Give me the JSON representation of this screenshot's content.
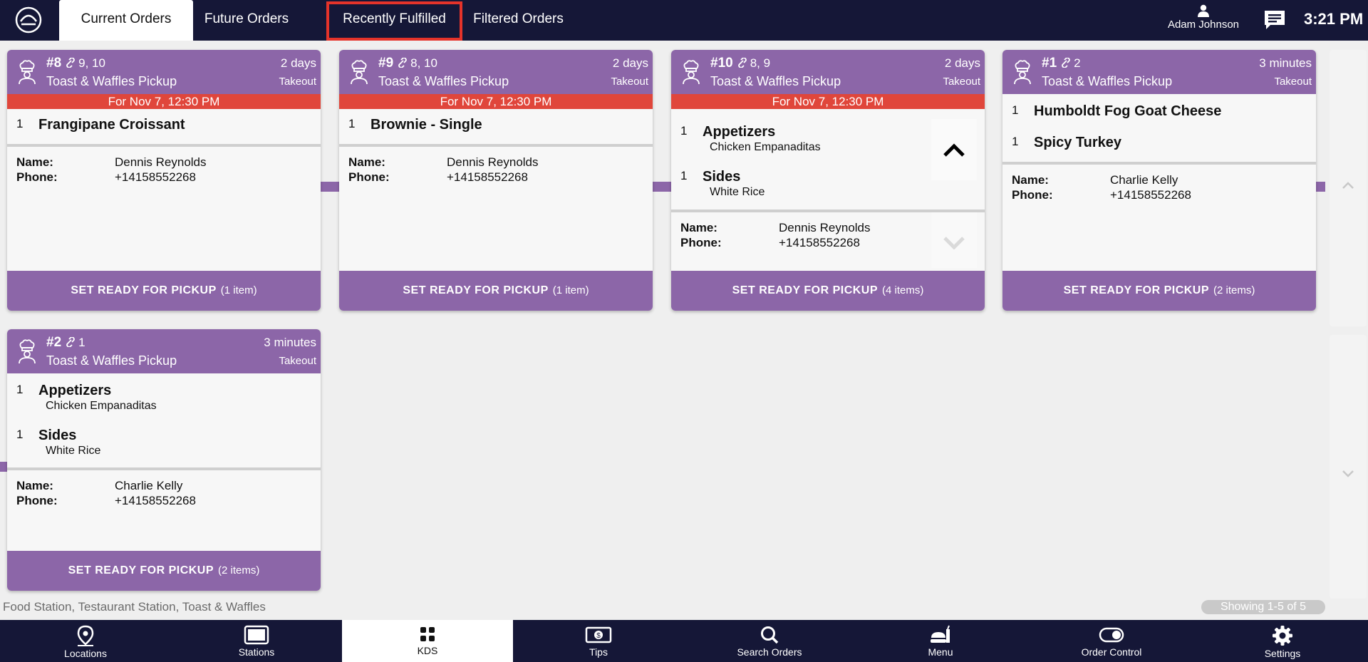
{
  "tabs": [
    {
      "label": "Current Orders"
    },
    {
      "label": "Future Orders"
    },
    {
      "label": "Recently Fulfilled"
    },
    {
      "label": "Filtered Orders"
    }
  ],
  "user": {
    "name": "Adam Johnson"
  },
  "clock": "3:21 PM",
  "labels": {
    "name": "Name:",
    "phone": "Phone:",
    "set_ready": "SET READY FOR PICKUP"
  },
  "orders": [
    {
      "number": "#8",
      "linked": "9, 10",
      "service": "Toast & Waffles Pickup",
      "age": "2 days",
      "type": "Takeout",
      "due": "For Nov 7, 12:30 PM",
      "items": [
        {
          "qty": "1",
          "name": "Frangipane Croissant"
        }
      ],
      "customer": {
        "name": "Dennis Reynolds",
        "phone": "+14158552268"
      },
      "item_count": "(1 item)"
    },
    {
      "number": "#9",
      "linked": "8, 10",
      "service": "Toast & Waffles Pickup",
      "age": "2 days",
      "type": "Takeout",
      "due": "For Nov 7, 12:30 PM",
      "items": [
        {
          "qty": "1",
          "name": "Brownie - Single"
        }
      ],
      "customer": {
        "name": "Dennis Reynolds",
        "phone": "+14158552268"
      },
      "item_count": "(1 item)"
    },
    {
      "number": "#10",
      "linked": "8, 9",
      "service": "Toast & Waffles Pickup",
      "age": "2 days",
      "type": "Takeout",
      "due": "For Nov 7, 12:30 PM",
      "items": [
        {
          "qty": "1",
          "name": "Appetizers",
          "modifier": "Chicken Empanaditas"
        },
        {
          "qty": "1",
          "name": "Sides",
          "modifier": "White Rice"
        }
      ],
      "customer": {
        "name": "Dennis Reynolds",
        "phone": "+14158552268"
      },
      "item_count": "(4 items)"
    },
    {
      "number": "#1",
      "linked": "2",
      "service": "Toast & Waffles Pickup",
      "age": "3 minutes",
      "type": "Takeout",
      "items": [
        {
          "qty": "1",
          "name": "Humboldt Fog Goat Cheese"
        },
        {
          "qty": "1",
          "name": "Spicy Turkey"
        }
      ],
      "customer": {
        "name": "Charlie Kelly",
        "phone": "+14158552268"
      },
      "item_count": "(2 items)"
    },
    {
      "number": "#2",
      "linked": "1",
      "service": "Toast & Waffles Pickup",
      "age": "3 minutes",
      "type": "Takeout",
      "items": [
        {
          "qty": "1",
          "name": "Appetizers",
          "modifier": "Chicken Empanaditas"
        },
        {
          "qty": "1",
          "name": "Sides",
          "modifier": "White Rice"
        }
      ],
      "customer": {
        "name": "Charlie Kelly",
        "phone": "+14158552268"
      },
      "item_count": "(2 items)"
    }
  ],
  "stations_text": "Food Station, Testaurant Station, Toast & Waffles",
  "showing_text": "Showing 1-5 of 5",
  "bottom_nav": [
    {
      "label": "Locations",
      "icon": "location-pin-icon"
    },
    {
      "label": "Stations",
      "icon": "tablet-icon"
    },
    {
      "label": "KDS",
      "icon": "grid-icon"
    },
    {
      "label": "Tips",
      "icon": "cash-icon"
    },
    {
      "label": "Search Orders",
      "icon": "search-icon"
    },
    {
      "label": "Menu",
      "icon": "food-icon"
    },
    {
      "label": "Order Control",
      "icon": "toggle-icon"
    },
    {
      "label": "Settings",
      "icon": "gear-icon"
    }
  ],
  "colors": {
    "header": "#151737",
    "card_header": "#8c66a8",
    "due_bar": "#e0463b",
    "highlight": "#e5332a"
  }
}
